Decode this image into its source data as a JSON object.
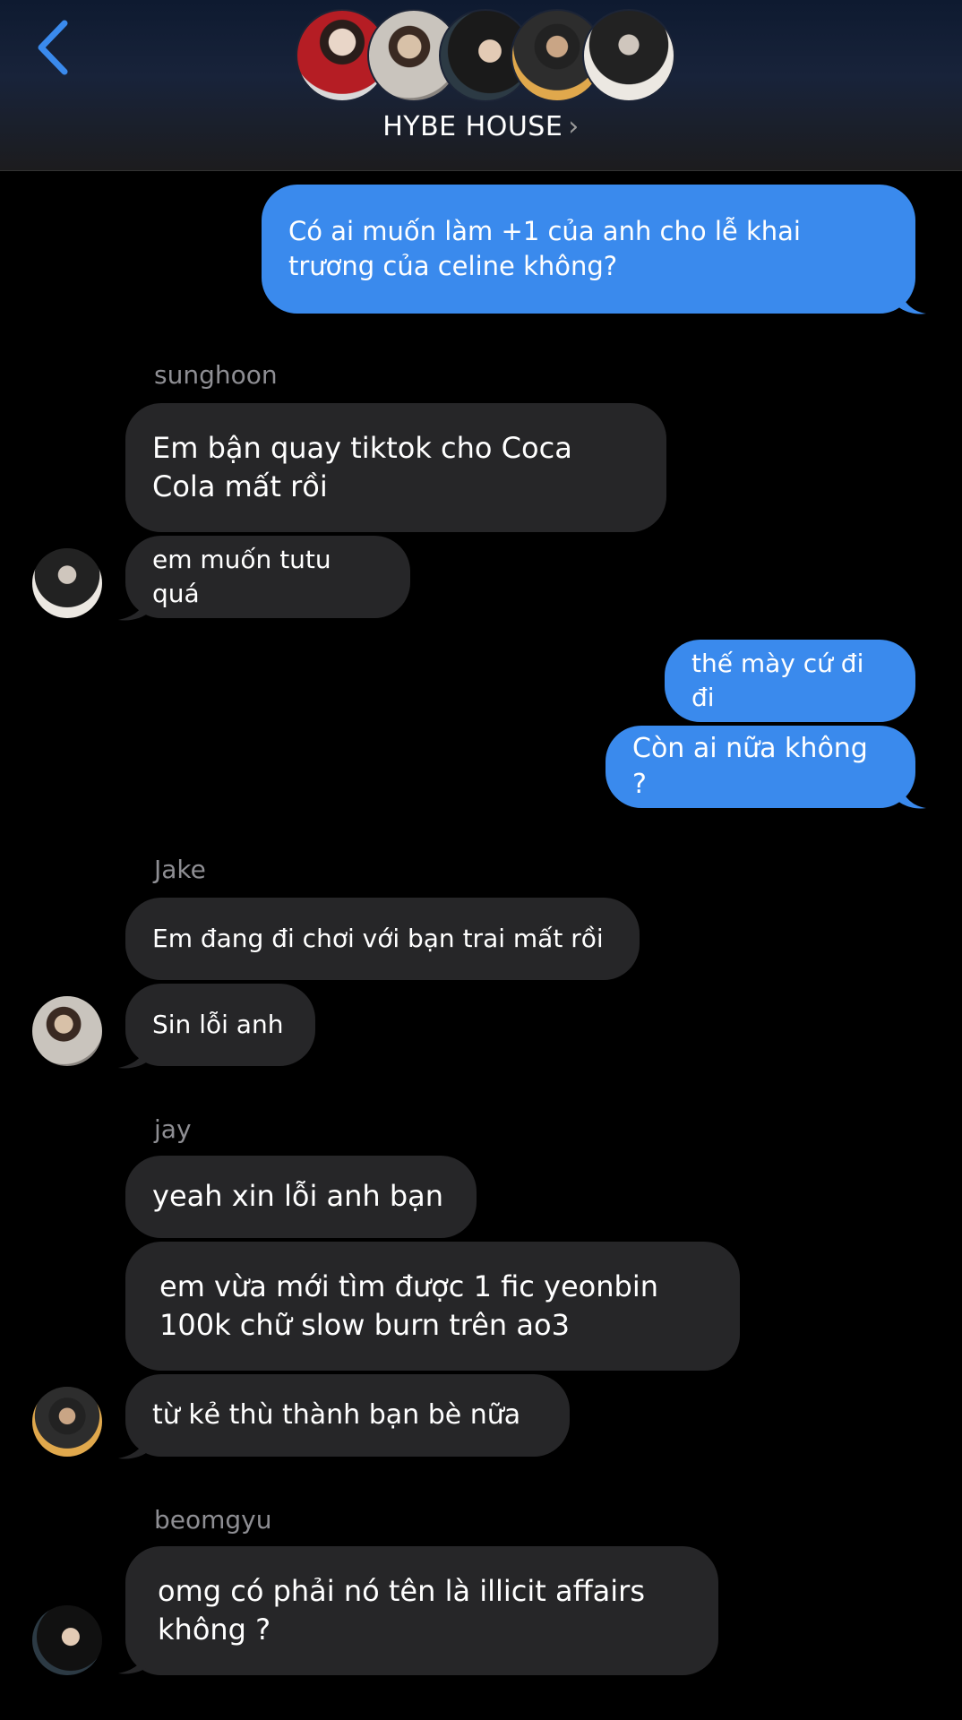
{
  "header": {
    "title": "HYBE HOUSE",
    "chevron": "›",
    "back_icon": "chevron-left-icon",
    "accent_color": "#3a8aed"
  },
  "messages": {
    "m1": "Có ai muốn làm +1 của anh cho lễ khai trương của celine không?",
    "sunghoon_name": "sunghoon",
    "m2": "Em bận quay tiktok cho Coca Cola mất rồi",
    "m3": "em muốn tutu quá",
    "m4": "thế mày cứ đi đi",
    "m5": "Còn ai nữa không ?",
    "jake_name": "Jake",
    "m6": "Em đang đi chơi với bạn trai mất rồi",
    "m7": "Sin lỗi anh",
    "jay_name": "jay",
    "m8": "yeah xin lỗi anh bạn",
    "m9": "em vừa mới tìm được 1 fic yeonbin 100k chữ slow burn trên ao3",
    "m10": "từ kẻ thù thành bạn bè nữa",
    "beomgyu_name": "beomgyu",
    "m11": "omg có phải nó tên là illicit affairs không ?"
  },
  "colors": {
    "outgoing_bubble": "#3a8aed",
    "incoming_bubble": "#262628",
    "sender_name": "#8e8e93",
    "background": "#000000"
  }
}
